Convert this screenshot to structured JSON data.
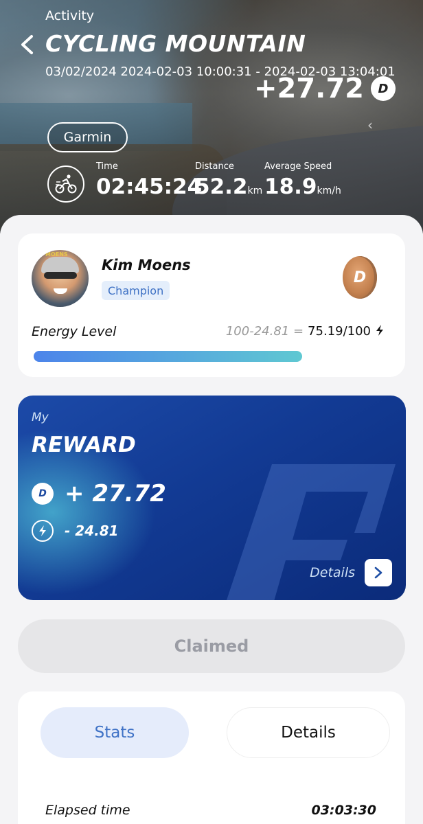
{
  "header": {
    "section_label": "Activity",
    "title": "CYCLING MOUNTAIN",
    "dates": "03/02/2024 2024-02-03 10:00:31 - 2024-02-03 13:04:01",
    "points": "+27.72",
    "device": "Garmin"
  },
  "summary": {
    "time_label": "Time",
    "time_value": "02:45:24",
    "distance_label": "Distance",
    "distance_value": "52.2",
    "distance_unit": "km",
    "speed_label": "Average Speed",
    "speed_value": "18.9",
    "speed_unit": "km/h"
  },
  "profile": {
    "name": "Kim Moens",
    "avatar_text": "MOENS",
    "rank": "Champion",
    "energy_label": "Energy Level",
    "energy_formula": "100-24.81 =",
    "energy_result": "75.19/100",
    "energy_fraction": 0.7519
  },
  "reward": {
    "my_label": "My",
    "title": "REWARD",
    "plus_value": "+ 27.72",
    "minus_value": "- 24.81",
    "details_label": "Details"
  },
  "claim": {
    "label": "Claimed"
  },
  "tabs": {
    "stats_label": "Stats",
    "details_label": "Details"
  },
  "stats": {
    "elapsed_label": "Elapsed time",
    "elapsed_value": "03:03:30"
  },
  "colors": {
    "accent_blue": "#3f72c6",
    "reward_bg": "#123a93",
    "energy_start": "#4c84ea",
    "energy_end": "#5fc8d2",
    "coin_bronze": "#c4814f"
  },
  "icons": {
    "back": "chevron-left-icon",
    "coin": "d-coin-icon",
    "bike": "cyclist-icon",
    "bolt": "lightning-icon",
    "details": "chevron-right-icon"
  }
}
